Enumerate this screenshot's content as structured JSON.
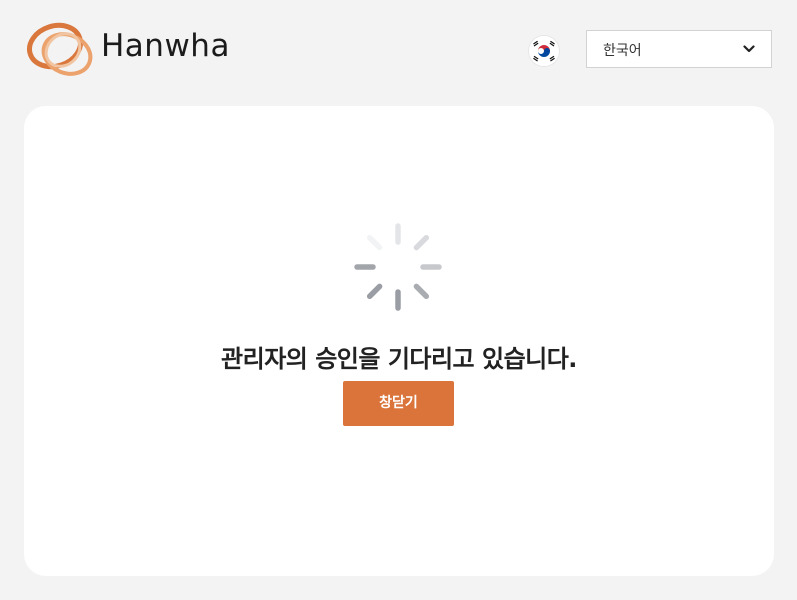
{
  "header": {
    "brand": "Hanwha",
    "language": {
      "selected": "한국어",
      "flag_icon": "south-korea-flag-icon"
    }
  },
  "main": {
    "status_message": "관리자의 승인을 기다리고 있습니다.",
    "close_button_label": "창닫기",
    "spinner_icon": "loading-spinner-icon"
  },
  "colors": {
    "accent": "#da743b",
    "background": "#f3f3f4",
    "card": "#ffffff"
  }
}
